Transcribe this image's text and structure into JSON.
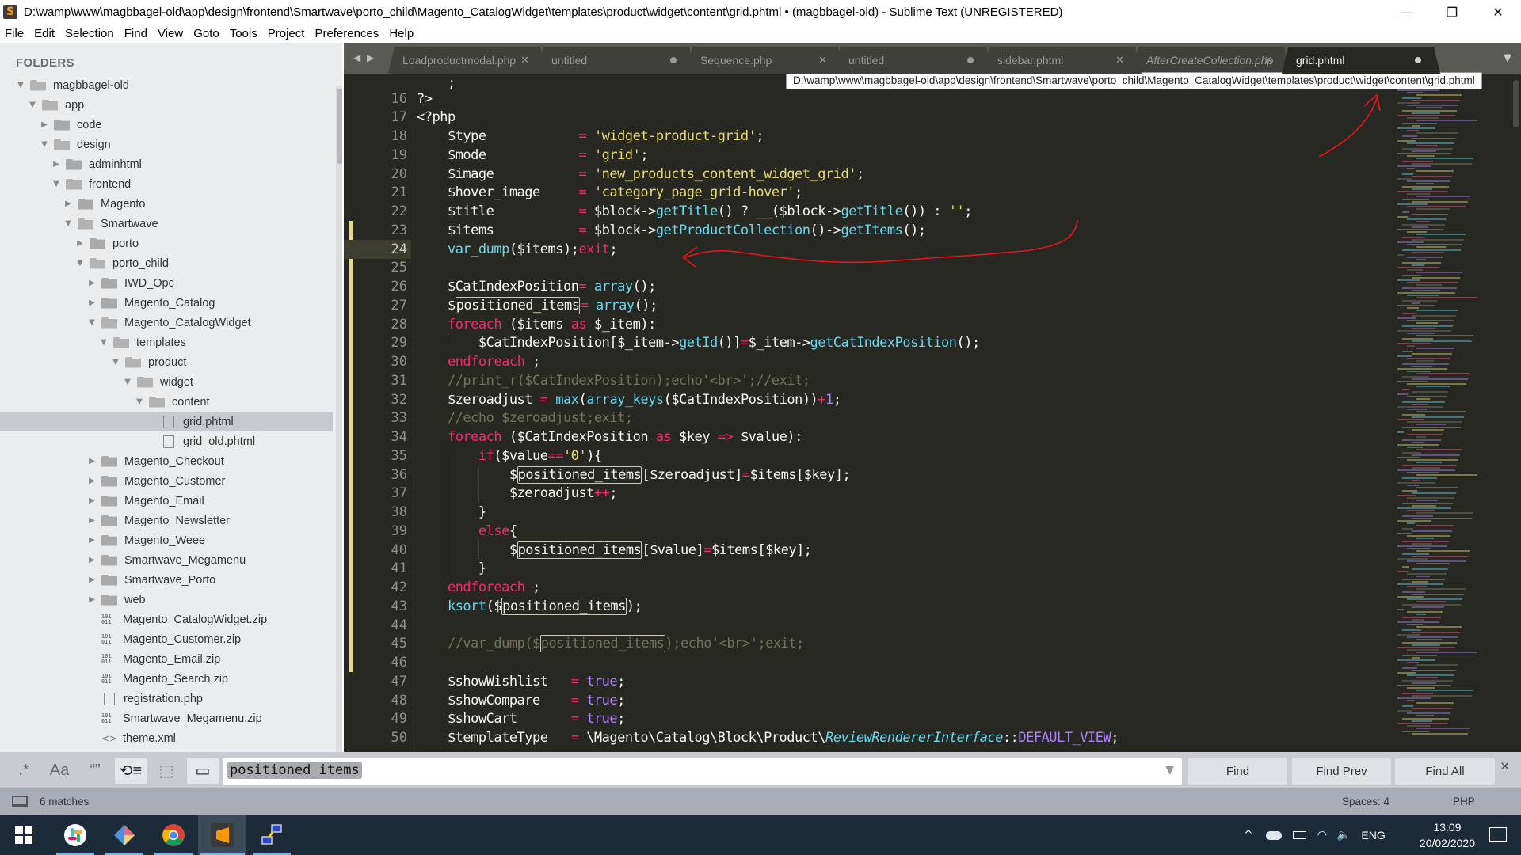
{
  "window": {
    "title": "D:\\wamp\\www\\magbbagel-old\\app\\design\\frontend\\Smartwave\\porto_child\\Magento_CatalogWidget\\templates\\product\\widget\\content\\grid.phtml • (magbbagel-old) - Sublime Text (UNREGISTERED)",
    "controls": {
      "minimize": "—",
      "restore": "❐",
      "close": "✕"
    }
  },
  "menu": [
    "File",
    "Edit",
    "Selection",
    "Find",
    "View",
    "Goto",
    "Tools",
    "Project",
    "Preferences",
    "Help"
  ],
  "sidebar": {
    "heading": "FOLDERS",
    "tree": [
      {
        "label": "magbbagel-old",
        "depth": 0,
        "kind": "folder",
        "state": "open"
      },
      {
        "label": "app",
        "depth": 1,
        "kind": "folder",
        "state": "open"
      },
      {
        "label": "code",
        "depth": 2,
        "kind": "folder",
        "state": "closed"
      },
      {
        "label": "design",
        "depth": 2,
        "kind": "folder",
        "state": "open"
      },
      {
        "label": "adminhtml",
        "depth": 3,
        "kind": "folder",
        "state": "closed"
      },
      {
        "label": "frontend",
        "depth": 3,
        "kind": "folder",
        "state": "open"
      },
      {
        "label": "Magento",
        "depth": 4,
        "kind": "folder",
        "state": "closed"
      },
      {
        "label": "Smartwave",
        "depth": 4,
        "kind": "folder",
        "state": "open"
      },
      {
        "label": "porto",
        "depth": 5,
        "kind": "folder",
        "state": "closed"
      },
      {
        "label": "porto_child",
        "depth": 5,
        "kind": "folder",
        "state": "open"
      },
      {
        "label": "IWD_Opc",
        "depth": 6,
        "kind": "folder",
        "state": "closed"
      },
      {
        "label": "Magento_Catalog",
        "depth": 6,
        "kind": "folder",
        "state": "closed"
      },
      {
        "label": "Magento_CatalogWidget",
        "depth": 6,
        "kind": "folder",
        "state": "open"
      },
      {
        "label": "templates",
        "depth": 7,
        "kind": "folder",
        "state": "open"
      },
      {
        "label": "product",
        "depth": 8,
        "kind": "folder",
        "state": "open"
      },
      {
        "label": "widget",
        "depth": 9,
        "kind": "folder",
        "state": "open"
      },
      {
        "label": "content",
        "depth": 10,
        "kind": "folder",
        "state": "open"
      },
      {
        "label": "grid.phtml",
        "depth": 11,
        "kind": "file",
        "selected": true
      },
      {
        "label": "grid_old.phtml",
        "depth": 11,
        "kind": "file"
      },
      {
        "label": "Magento_Checkout",
        "depth": 6,
        "kind": "folder",
        "state": "closed"
      },
      {
        "label": "Magento_Customer",
        "depth": 6,
        "kind": "folder",
        "state": "closed"
      },
      {
        "label": "Magento_Email",
        "depth": 6,
        "kind": "folder",
        "state": "closed"
      },
      {
        "label": "Magento_Newsletter",
        "depth": 6,
        "kind": "folder",
        "state": "closed"
      },
      {
        "label": "Magento_Weee",
        "depth": 6,
        "kind": "folder",
        "state": "closed"
      },
      {
        "label": "Smartwave_Megamenu",
        "depth": 6,
        "kind": "folder",
        "state": "closed"
      },
      {
        "label": "Smartwave_Porto",
        "depth": 6,
        "kind": "folder",
        "state": "closed"
      },
      {
        "label": "web",
        "depth": 6,
        "kind": "folder",
        "state": "closed"
      },
      {
        "label": "Magento_CatalogWidget.zip",
        "depth": 6,
        "kind": "binary"
      },
      {
        "label": "Magento_Customer.zip",
        "depth": 6,
        "kind": "binary"
      },
      {
        "label": "Magento_Email.zip",
        "depth": 6,
        "kind": "binary"
      },
      {
        "label": "Magento_Search.zip",
        "depth": 6,
        "kind": "binary"
      },
      {
        "label": "registration.php",
        "depth": 6,
        "kind": "file"
      },
      {
        "label": "Smartwave_Megamenu.zip",
        "depth": 6,
        "kind": "binary"
      },
      {
        "label": "theme.xml",
        "depth": 6,
        "kind": "xml"
      }
    ]
  },
  "tabs": {
    "nav": "◀ ▶",
    "items": [
      {
        "label": "Loadproductmodal.php",
        "status": "close"
      },
      {
        "label": "untitled",
        "status": "dirty"
      },
      {
        "label": "Sequence.php",
        "status": "close"
      },
      {
        "label": "untitled",
        "status": "dirty"
      },
      {
        "label": "sidebar.phtml",
        "status": "close"
      },
      {
        "label": "AfterCreateCollection.php",
        "status": "close",
        "italic": true
      },
      {
        "label": "grid.phtml",
        "status": "dirty",
        "active": true
      }
    ],
    "close_glyph": "✕",
    "overflow_glyph": "▼"
  },
  "tooltip": "D:\\wamp\\www\\magbbagel-old\\app\\design\\frontend\\Smartwave\\porto_child\\Magento_CatalogWidget\\templates\\product\\widget\\content\\grid.phtml",
  "editor": {
    "current_line": 24,
    "partial_top": "    ;",
    "lines": [
      {
        "n": 16,
        "tokens": [
          [
            "?>",
            ""
          ]
        ]
      },
      {
        "n": 17,
        "tokens": [
          [
            "<?php",
            ""
          ]
        ]
      },
      {
        "n": 18,
        "tokens": [
          [
            "    $type            ",
            ""
          ],
          [
            "=",
            "k"
          ],
          [
            " ",
            ""
          ],
          [
            "'widget-product-grid'",
            "s"
          ],
          [
            ";",
            ""
          ]
        ]
      },
      {
        "n": 19,
        "tokens": [
          [
            "    $mode            ",
            ""
          ],
          [
            "=",
            "k"
          ],
          [
            " ",
            ""
          ],
          [
            "'grid'",
            "s"
          ],
          [
            ";",
            ""
          ]
        ]
      },
      {
        "n": 20,
        "tokens": [
          [
            "    $image           ",
            ""
          ],
          [
            "=",
            "k"
          ],
          [
            " ",
            ""
          ],
          [
            "'new_products_content_widget_grid'",
            "s"
          ],
          [
            ";",
            ""
          ]
        ]
      },
      {
        "n": 21,
        "tokens": [
          [
            "    $hover_image     ",
            ""
          ],
          [
            "=",
            "k"
          ],
          [
            " ",
            ""
          ],
          [
            "'category_page_grid-hover'",
            "s"
          ],
          [
            ";",
            ""
          ]
        ]
      },
      {
        "n": 22,
        "tokens": [
          [
            "    $title           ",
            ""
          ],
          [
            "=",
            "k"
          ],
          [
            " $block->",
            ""
          ],
          [
            "getTitle",
            "f"
          ],
          [
            "() ? __($block->",
            ""
          ],
          [
            "getTitle",
            "f"
          ],
          [
            "()) : ",
            ""
          ],
          [
            "''",
            "s"
          ],
          [
            ";",
            ""
          ]
        ]
      },
      {
        "n": 23,
        "tokens": [
          [
            "    $items           ",
            ""
          ],
          [
            "=",
            "k"
          ],
          [
            " $block->",
            ""
          ],
          [
            "getProductCollection",
            "f"
          ],
          [
            "()->",
            ""
          ],
          [
            "getItems",
            "f"
          ],
          [
            "();",
            ""
          ]
        ]
      },
      {
        "n": 24,
        "tokens": [
          [
            "    ",
            ""
          ],
          [
            "var_dump",
            "f"
          ],
          [
            "($items);",
            ""
          ],
          [
            "exit",
            "k"
          ],
          [
            ";",
            ""
          ]
        ]
      },
      {
        "n": 25,
        "tokens": []
      },
      {
        "n": 26,
        "tokens": [
          [
            "    $CatIndexPosition",
            ""
          ],
          [
            "=",
            "k"
          ],
          [
            " ",
            ""
          ],
          [
            "array",
            "f"
          ],
          [
            "();",
            ""
          ]
        ]
      },
      {
        "n": 27,
        "tokens": [
          [
            "    $",
            ""
          ],
          [
            "positioned_items",
            "hl"
          ],
          [
            "=",
            "k"
          ],
          [
            " ",
            ""
          ],
          [
            "array",
            "f"
          ],
          [
            "();",
            ""
          ]
        ]
      },
      {
        "n": 28,
        "tokens": [
          [
            "    ",
            ""
          ],
          [
            "foreach",
            "k"
          ],
          [
            " ($items ",
            ""
          ],
          [
            "as",
            "k"
          ],
          [
            " $_item):",
            ""
          ]
        ]
      },
      {
        "n": 29,
        "tokens": [
          [
            "        $CatIndexPosition[$_item->",
            ""
          ],
          [
            "getId",
            "f"
          ],
          [
            "()]",
            ""
          ],
          [
            "=",
            "k"
          ],
          [
            "$_item->",
            ""
          ],
          [
            "getCatIndexPosition",
            "f"
          ],
          [
            "();",
            ""
          ]
        ]
      },
      {
        "n": 30,
        "tokens": [
          [
            "    ",
            ""
          ],
          [
            "endforeach",
            "k"
          ],
          [
            " ;",
            ""
          ]
        ]
      },
      {
        "n": 31,
        "tokens": [
          [
            "    //print_r($CatIndexPosition);echo'<br>';//exit;",
            "c"
          ]
        ]
      },
      {
        "n": 32,
        "tokens": [
          [
            "    $zeroadjust ",
            ""
          ],
          [
            "=",
            "k"
          ],
          [
            " ",
            ""
          ],
          [
            "max",
            "f"
          ],
          [
            "(",
            ""
          ],
          [
            "array_keys",
            "f"
          ],
          [
            "($CatIndexPosition))",
            ""
          ],
          [
            "+",
            "k"
          ],
          [
            "1",
            "n"
          ],
          [
            ";",
            ""
          ]
        ]
      },
      {
        "n": 33,
        "tokens": [
          [
            "    //echo $zeroadjust;exit;",
            "c"
          ]
        ]
      },
      {
        "n": 34,
        "tokens": [
          [
            "    ",
            ""
          ],
          [
            "foreach",
            "k"
          ],
          [
            " ($CatIndexPosition ",
            ""
          ],
          [
            "as",
            "k"
          ],
          [
            " $key ",
            ""
          ],
          [
            "=>",
            "k"
          ],
          [
            " $value):",
            ""
          ]
        ]
      },
      {
        "n": 35,
        "tokens": [
          [
            "        ",
            ""
          ],
          [
            "if",
            "k"
          ],
          [
            "($value",
            ""
          ],
          [
            "==",
            "k"
          ],
          [
            "'0'",
            "s"
          ],
          [
            "){",
            ""
          ]
        ]
      },
      {
        "n": 36,
        "tokens": [
          [
            "            $",
            ""
          ],
          [
            "positioned_items",
            "hl"
          ],
          [
            "[$zeroadjust]",
            ""
          ],
          [
            "=",
            "k"
          ],
          [
            "$items[$key];",
            ""
          ]
        ]
      },
      {
        "n": 37,
        "tokens": [
          [
            "            $zeroadjust",
            ""
          ],
          [
            "++",
            "k"
          ],
          [
            ";",
            ""
          ]
        ]
      },
      {
        "n": 38,
        "tokens": [
          [
            "        }",
            ""
          ]
        ]
      },
      {
        "n": 39,
        "tokens": [
          [
            "        ",
            ""
          ],
          [
            "else",
            "k"
          ],
          [
            "{",
            ""
          ]
        ]
      },
      {
        "n": 40,
        "tokens": [
          [
            "            $",
            ""
          ],
          [
            "positioned_items",
            "hl"
          ],
          [
            "[$value]",
            ""
          ],
          [
            "=",
            "k"
          ],
          [
            "$items[$key];",
            ""
          ]
        ]
      },
      {
        "n": 41,
        "tokens": [
          [
            "        }",
            ""
          ]
        ]
      },
      {
        "n": 42,
        "tokens": [
          [
            "    ",
            ""
          ],
          [
            "endforeach",
            "k"
          ],
          [
            " ;",
            ""
          ]
        ]
      },
      {
        "n": 43,
        "tokens": [
          [
            "    ",
            ""
          ],
          [
            "ksort",
            "f"
          ],
          [
            "($",
            ""
          ],
          [
            "positioned_items",
            "hl"
          ],
          [
            ");",
            ""
          ]
        ]
      },
      {
        "n": 44,
        "tokens": []
      },
      {
        "n": 45,
        "tokens": [
          [
            "    //var_dump($",
            "c"
          ],
          [
            "positioned_items",
            "hlc"
          ],
          [
            ");echo'<br>';exit;",
            "c"
          ]
        ]
      },
      {
        "n": 46,
        "tokens": []
      },
      {
        "n": 47,
        "tokens": [
          [
            "    $showWishlist   ",
            ""
          ],
          [
            "=",
            "k"
          ],
          [
            " ",
            ""
          ],
          [
            "true",
            "n"
          ],
          [
            ";",
            ""
          ]
        ]
      },
      {
        "n": 48,
        "tokens": [
          [
            "    $showCompare    ",
            ""
          ],
          [
            "=",
            "k"
          ],
          [
            " ",
            ""
          ],
          [
            "true",
            "n"
          ],
          [
            ";",
            ""
          ]
        ]
      },
      {
        "n": 49,
        "tokens": [
          [
            "    $showCart       ",
            ""
          ],
          [
            "=",
            "k"
          ],
          [
            " ",
            ""
          ],
          [
            "true",
            "n"
          ],
          [
            ";",
            ""
          ]
        ]
      },
      {
        "n": 50,
        "tokens": [
          [
            "    $templateType   ",
            ""
          ],
          [
            "=",
            "k"
          ],
          [
            " \\Magento\\Catalog\\Block\\Product\\",
            ""
          ],
          [
            "ReviewRendererInterface",
            "fi"
          ],
          [
            "::",
            ""
          ],
          [
            "DEFAULT_VIEW",
            "n"
          ],
          [
            ";",
            ""
          ]
        ]
      }
    ],
    "modified_lines": [
      23,
      46
    ]
  },
  "find_panel": {
    "options": [
      {
        "name": "regex",
        "glyph": ".*",
        "on": false
      },
      {
        "name": "case-sensitive",
        "glyph": "Aa",
        "on": false
      },
      {
        "name": "whole-word",
        "glyph": "“”",
        "on": false
      },
      {
        "name": "wrap",
        "glyph": "⟲≡",
        "on": true
      },
      {
        "name": "in-selection",
        "glyph": "⬚",
        "on": false
      },
      {
        "name": "highlight-matches",
        "glyph": "▭",
        "on": true
      }
    ],
    "query": "positioned_items",
    "buttons": {
      "find": "Find",
      "find_prev": "Find Prev",
      "find_all": "Find All"
    },
    "close_glyph": "✕"
  },
  "statusbar": {
    "matches": "6 matches",
    "indent": "Spaces: 4",
    "syntax": "PHP"
  },
  "taskbar": {
    "apps": [
      "Start",
      "Slack",
      "Sourcetree",
      "Chrome",
      "Sublime Text",
      "Network"
    ],
    "tray": {
      "language": "ENG",
      "time": "13:09",
      "date": "20/02/2020"
    }
  },
  "colors": {
    "editor_bg": "#272822",
    "keyword": "#f92672",
    "string": "#e6db74",
    "function": "#66d9ef",
    "comment": "#75715e",
    "number": "#ae81ff",
    "annotation": "#e8141c"
  }
}
